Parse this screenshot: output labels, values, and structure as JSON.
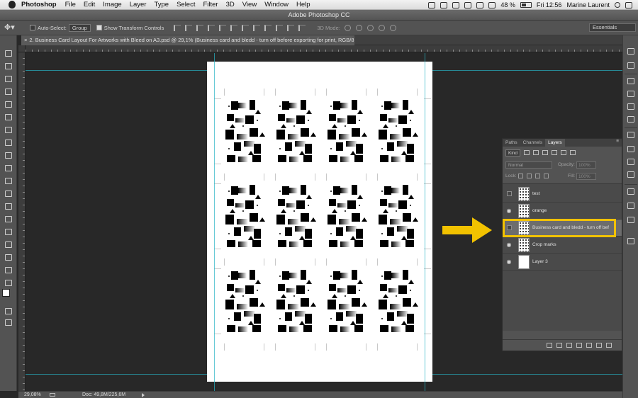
{
  "menubar": {
    "app": "Photoshop",
    "items": [
      "File",
      "Edit",
      "Image",
      "Layer",
      "Type",
      "Select",
      "Filter",
      "3D",
      "View",
      "Window",
      "Help"
    ],
    "battery": "48 %",
    "clock": "Fri 12:56",
    "user": "Marine Laurent"
  },
  "window": {
    "title": "Adobe Photoshop CC"
  },
  "options": {
    "auto_select_label": "Auto-Select:",
    "auto_select_value": "Group",
    "transform_label": "Show Transform Controls",
    "mode_3d": "3D Mode:",
    "workspace": "Essentials"
  },
  "document": {
    "tab_title": "2. Business Card Layout For Artworks with Bleed on A3.psd @ 29,1% (Business card and bledd - turn off before exporting for print, RGB/8)"
  },
  "status": {
    "zoom": "29,08%",
    "doc": "Doc: 49,8M/225,6M"
  },
  "layers_panel": {
    "tabs": [
      "Paths",
      "Channels",
      "Layers"
    ],
    "active_tab": "Layers",
    "kind": "Kind",
    "blend_mode": "Normal",
    "opacity_label": "Opacity:",
    "opacity_value": "100%",
    "lock_label": "Lock:",
    "fill_label": "Fill:",
    "fill_value": "100%",
    "layers": [
      {
        "name": "test",
        "visible": false
      },
      {
        "name": "orange",
        "visible": true
      },
      {
        "name": "Business card and bledd - turn off bef",
        "visible": false,
        "selected": true
      },
      {
        "name": "Crop marks",
        "visible": true
      },
      {
        "name": "Layer 3",
        "visible": true
      }
    ]
  },
  "colors": {
    "highlight": "#f2c200",
    "arrow": "#f2c200",
    "guides": "#27b4c4"
  }
}
